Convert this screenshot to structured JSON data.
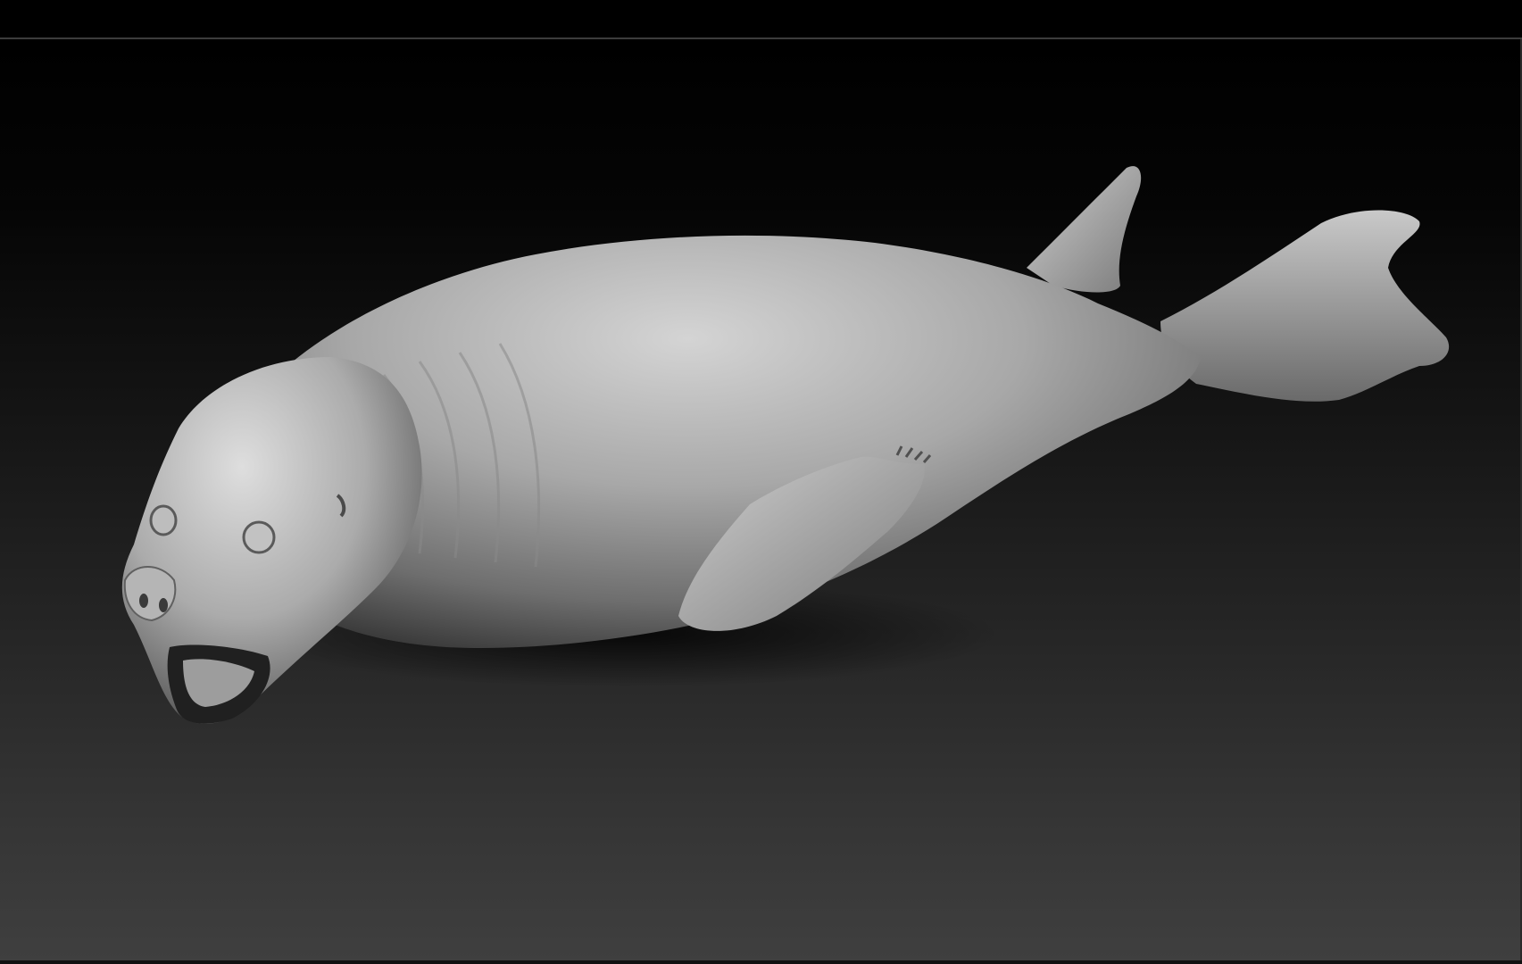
{
  "scene": {
    "subject": "seal-sculpt",
    "colors": {
      "background_top": "#000000",
      "background_bottom": "#3f3f3f",
      "material_light": "#d9d9d9",
      "material_mid": "#a3a3a3",
      "material_dark": "#4a4a4a",
      "shadow": "#050505"
    }
  }
}
